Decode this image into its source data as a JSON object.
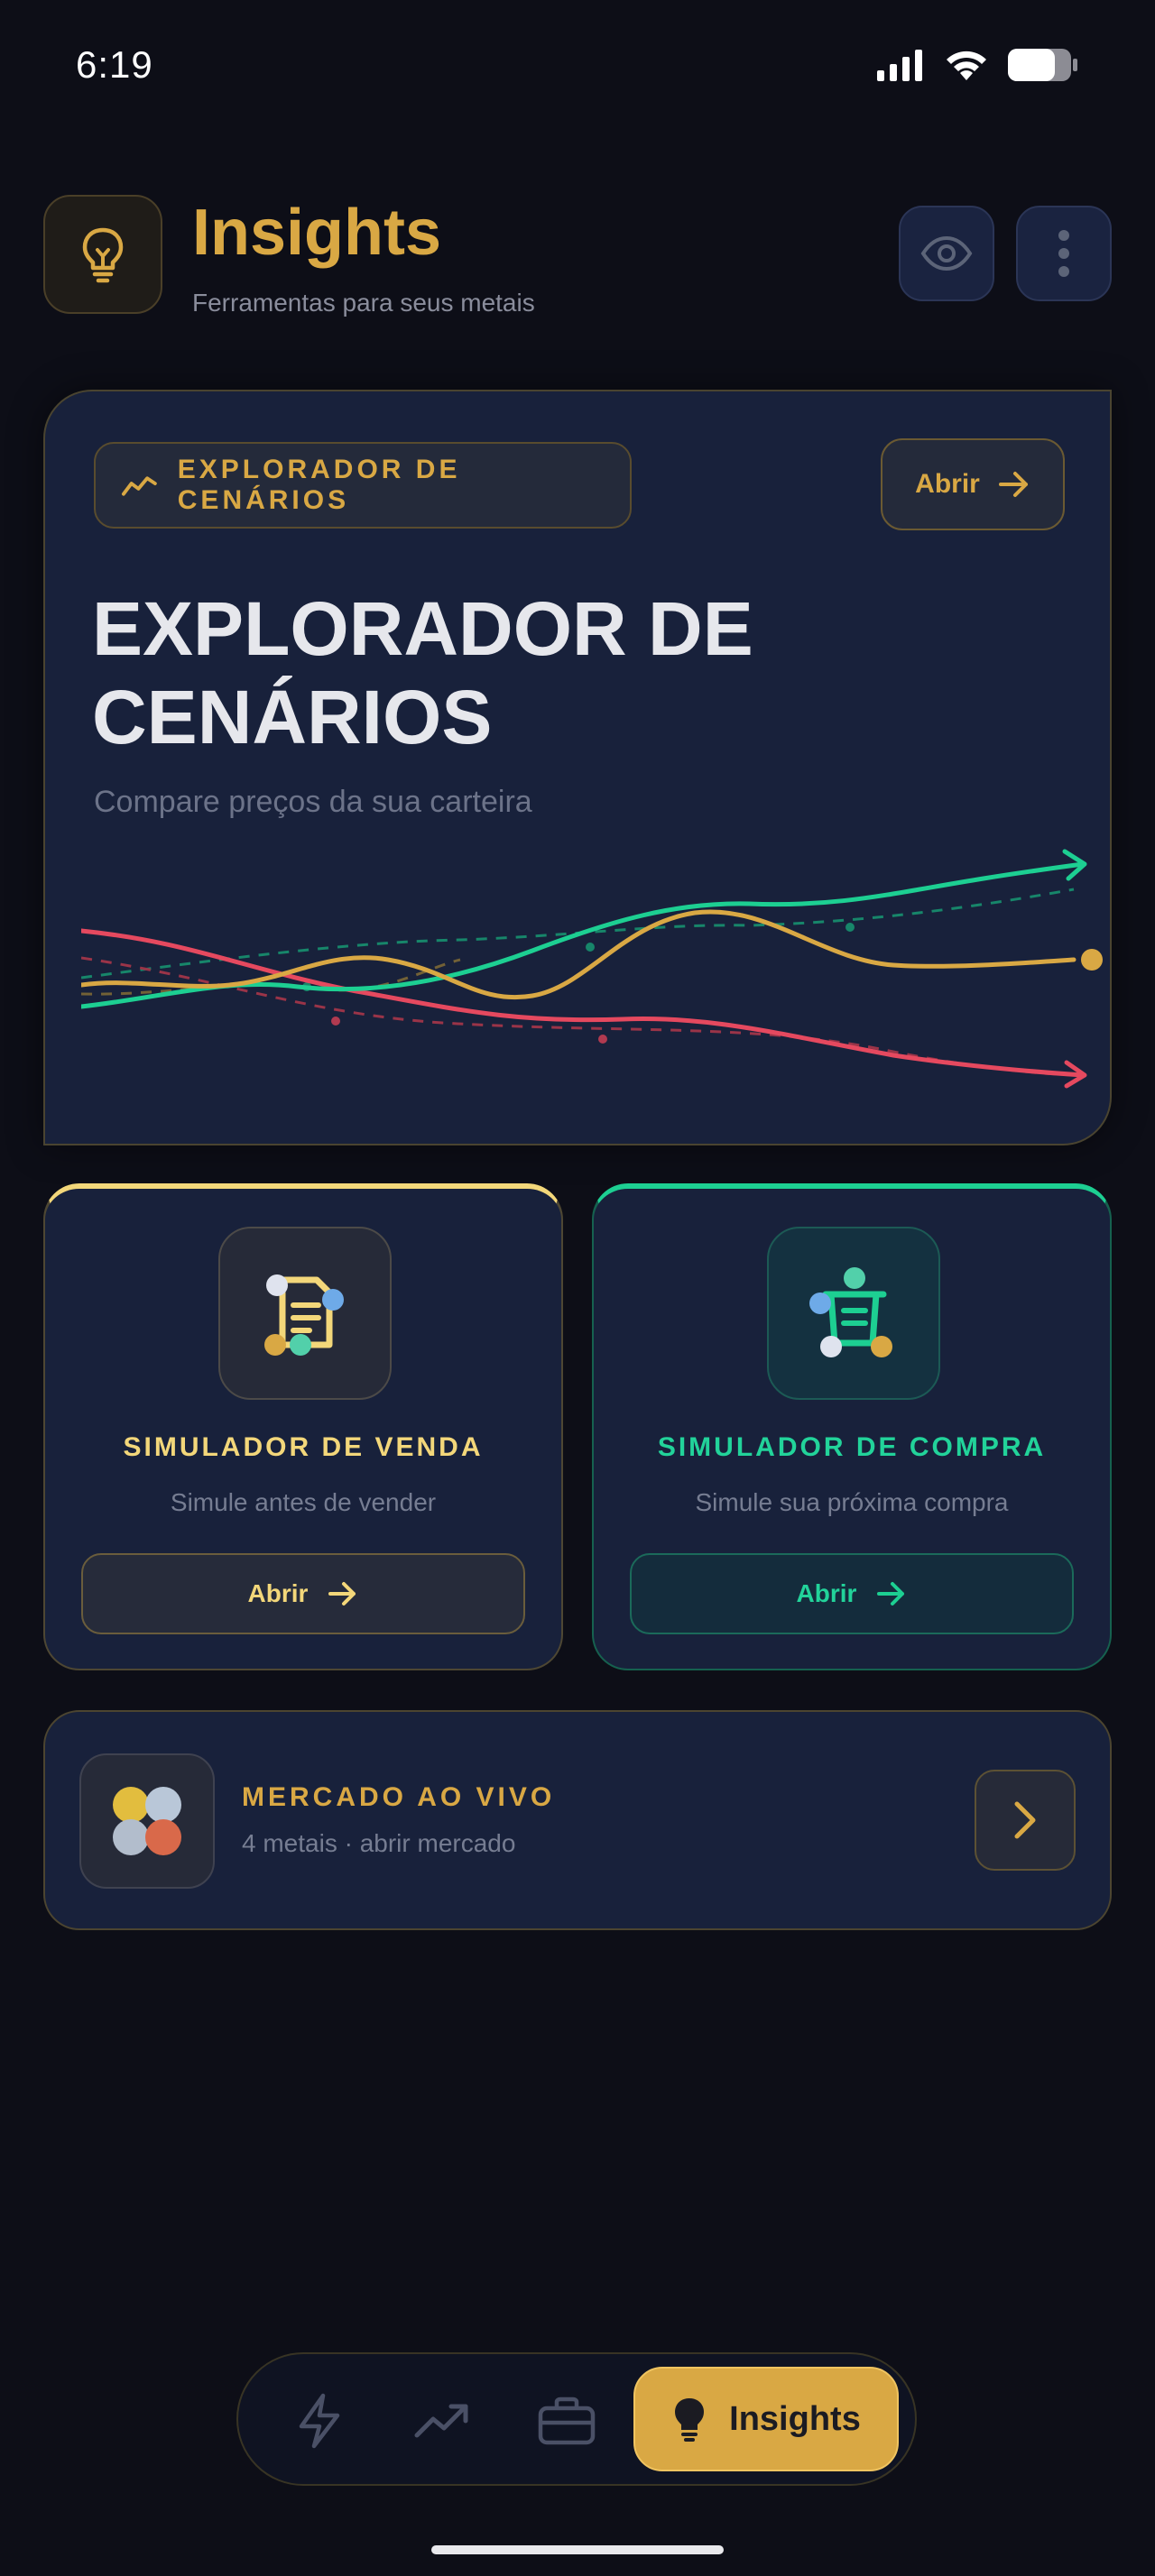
{
  "status_bar": {
    "time": "6:19"
  },
  "header": {
    "title": "Insights",
    "subtitle": "Ferramentas para seus metais",
    "logo_icon": "lightbulb-icon",
    "eye_icon": "eye-icon",
    "more_icon": "more-vertical-icon"
  },
  "hero": {
    "pill_label": "EXPLORADOR DE CENÁRIOS",
    "pill_icon": "trending-icon",
    "open_label": "Abrir",
    "title": "EXPLORADOR DE CENÁRIOS",
    "description": "Compare preços da sua carteira",
    "colors": {
      "green": "#1dcf92",
      "gold": "#d9a844",
      "red": "#e5495f"
    }
  },
  "sell_card": {
    "title": "SIMULADOR DE VENDA",
    "description": "Simule antes de vender",
    "button_label": "Abrir",
    "accent": "#f3d77a"
  },
  "buy_card": {
    "title": "SIMULADOR DE COMPRA",
    "description": "Simule sua próxima compra",
    "button_label": "Abrir",
    "accent": "#1dcf92"
  },
  "market_card": {
    "title": "MERCADO AO VIVO",
    "subtitle": "4 metais · abrir mercado"
  },
  "bottom_nav": {
    "items": [
      {
        "icon": "lightning-icon"
      },
      {
        "icon": "trending-up-icon"
      },
      {
        "icon": "briefcase-icon"
      }
    ],
    "active_label": "Insights",
    "active_icon": "lightbulb-icon"
  }
}
